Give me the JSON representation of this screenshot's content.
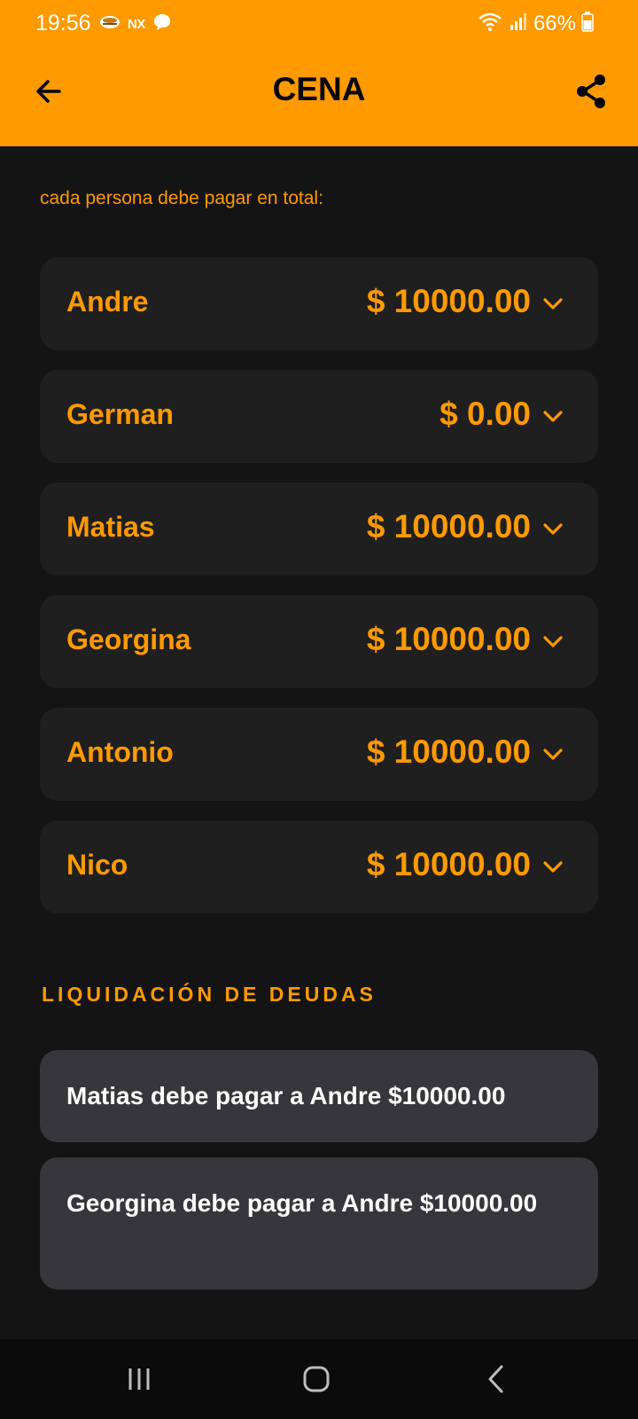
{
  "status_bar": {
    "time": "19:56",
    "nx_label": "NX",
    "battery_percent": "66%",
    "icons_left": [
      "notification-app-icon",
      "nx-icon",
      "chat-bubble-icon"
    ],
    "icons_right": [
      "wifi-icon",
      "signal-icon",
      "battery-icon"
    ]
  },
  "app_bar": {
    "title": "CENA",
    "back_icon": "arrow-left-icon",
    "share_icon": "share-icon",
    "background_color": "#FF9A00"
  },
  "summary": {
    "subtitle": "cada persona debe pagar en total:",
    "people": [
      {
        "name": "Andre",
        "amount": "$ 10000.00"
      },
      {
        "name": "German",
        "amount": "$ 0.00"
      },
      {
        "name": "Matias",
        "amount": "$ 10000.00"
      },
      {
        "name": "Georgina",
        "amount": "$ 10000.00"
      },
      {
        "name": "Antonio",
        "amount": "$ 10000.00"
      },
      {
        "name": "Nico",
        "amount": "$ 10000.00"
      }
    ]
  },
  "settlement": {
    "header": "LIQUIDACIÓN DE DEUDAS",
    "items": [
      {
        "text": "Matias debe pagar a Andre $10000.00"
      },
      {
        "text": "Georgina debe pagar a Andre $10000.00"
      }
    ]
  },
  "nav_bar": {
    "buttons": [
      "recent-apps-icon",
      "home-icon",
      "back-icon"
    ]
  },
  "colors": {
    "accent": "#FF9A00",
    "background": "#141414",
    "card": "#1f1f1f",
    "debt_card": "#36363c"
  }
}
